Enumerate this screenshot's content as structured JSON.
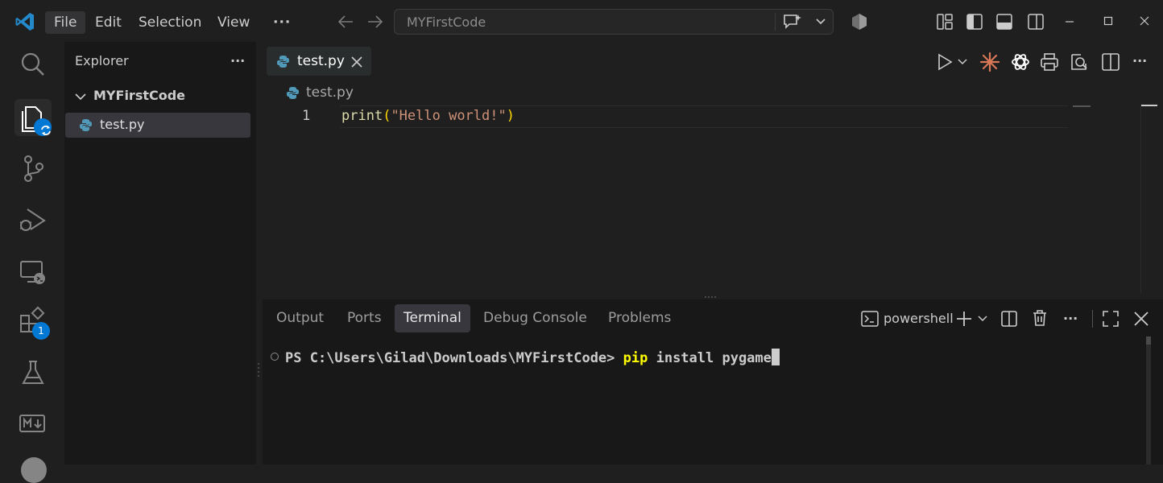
{
  "titlebar": {
    "menus": [
      "File",
      "Edit",
      "Selection",
      "View"
    ],
    "more_label": "···",
    "search_text": "MYFirstCode"
  },
  "activitybar": {
    "extensions_badge": "1"
  },
  "sidebar": {
    "title": "Explorer",
    "more_label": "···",
    "folder_name": "MYFirstCode",
    "files": [
      "test.py"
    ]
  },
  "editor": {
    "tab_label": "test.py",
    "breadcrumb_file": "test.py",
    "line_number": "1",
    "code": {
      "func": "print",
      "open_paren": "(",
      "string": "\"Hello world!\"",
      "close_paren": ")"
    }
  },
  "panel": {
    "tabs": [
      "Output",
      "Ports",
      "Terminal",
      "Debug Console",
      "Problems"
    ],
    "active_tab": "Terminal",
    "shell_name": "powershell",
    "more_label": "···",
    "terminal": {
      "prompt": "PS C:\\Users\\Gilad\\Downloads\\MYFirstCode> ",
      "command": "pip",
      "args": " install pygame"
    }
  },
  "colors": {
    "accent": "#0078d4",
    "string": "#ce9178",
    "bracket": "#ffd700",
    "function": "#dcdcaa",
    "python_icon": "#519aba",
    "command": "#ffff00"
  }
}
